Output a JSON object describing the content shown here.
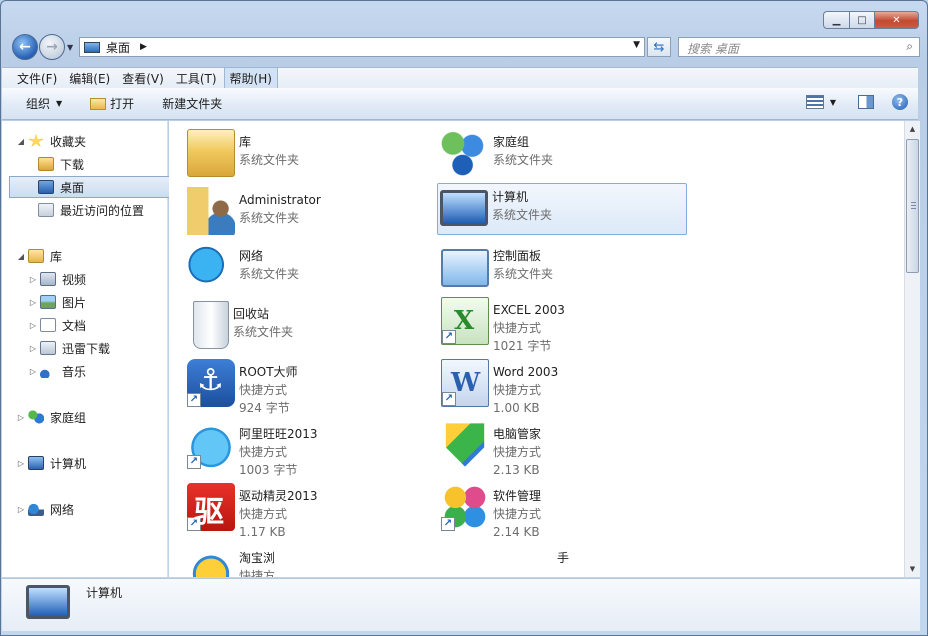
{
  "window": {
    "caption_buttons": {
      "minimize": "▁",
      "maximize": "□",
      "close": "✕"
    }
  },
  "address_bar": {
    "path": "桌面",
    "search_placeholder": "搜索 桌面"
  },
  "menu": [
    "文件(F)",
    "编辑(E)",
    "查看(V)",
    "工具(T)",
    "帮助(H)"
  ],
  "menu_active_index": 4,
  "toolbar": {
    "organize": "组织",
    "open": "打开",
    "new_folder": "新建文件夹"
  },
  "nav": {
    "favorites": "收藏夹",
    "downloads": "下载",
    "desktop": "桌面",
    "recent": "最近访问的位置",
    "libraries": "库",
    "videos": "视频",
    "pictures": "图片",
    "documents": "文档",
    "xunlei": "迅雷下载",
    "music": "音乐",
    "homegroup": "家庭组",
    "computer": "计算机",
    "network": "网络"
  },
  "items": [
    {
      "name": "库",
      "type": "系统文件夹",
      "size": ""
    },
    {
      "name": "家庭组",
      "type": "系统文件夹",
      "size": ""
    },
    {
      "name": "Administrator",
      "type": "系统文件夹",
      "size": ""
    },
    {
      "name": "计算机",
      "type": "系统文件夹",
      "size": ""
    },
    {
      "name": "网络",
      "type": "系统文件夹",
      "size": ""
    },
    {
      "name": "控制面板",
      "type": "系统文件夹",
      "size": ""
    },
    {
      "name": "回收站",
      "type": "系统文件夹",
      "size": ""
    },
    {
      "name": "EXCEL 2003",
      "type": "快捷方式",
      "size": "1021 字节"
    },
    {
      "name": "ROOT大师",
      "type": "快捷方式",
      "size": "924 字节"
    },
    {
      "name": "Word 2003",
      "type": "快捷方式",
      "size": "1.00 KB"
    },
    {
      "name": "阿里旺旺2013",
      "type": "快捷方式",
      "size": "1003 字节"
    },
    {
      "name": "电脑管家",
      "type": "快捷方式",
      "size": "2.13 KB"
    },
    {
      "name": "驱动精灵2013",
      "type": "快捷方式",
      "size": "1.17 KB"
    },
    {
      "name": "软件管理",
      "type": "快捷方式",
      "size": "2.14 KB"
    },
    {
      "name": "淘宝浏",
      "type": "快捷方",
      "size": ""
    },
    {
      "name": "手",
      "type": "",
      "size": ""
    }
  ],
  "details": {
    "selected_name": "计算机"
  },
  "colors": {
    "selection": "#dce9f8",
    "accent": "#2a6fc4"
  }
}
